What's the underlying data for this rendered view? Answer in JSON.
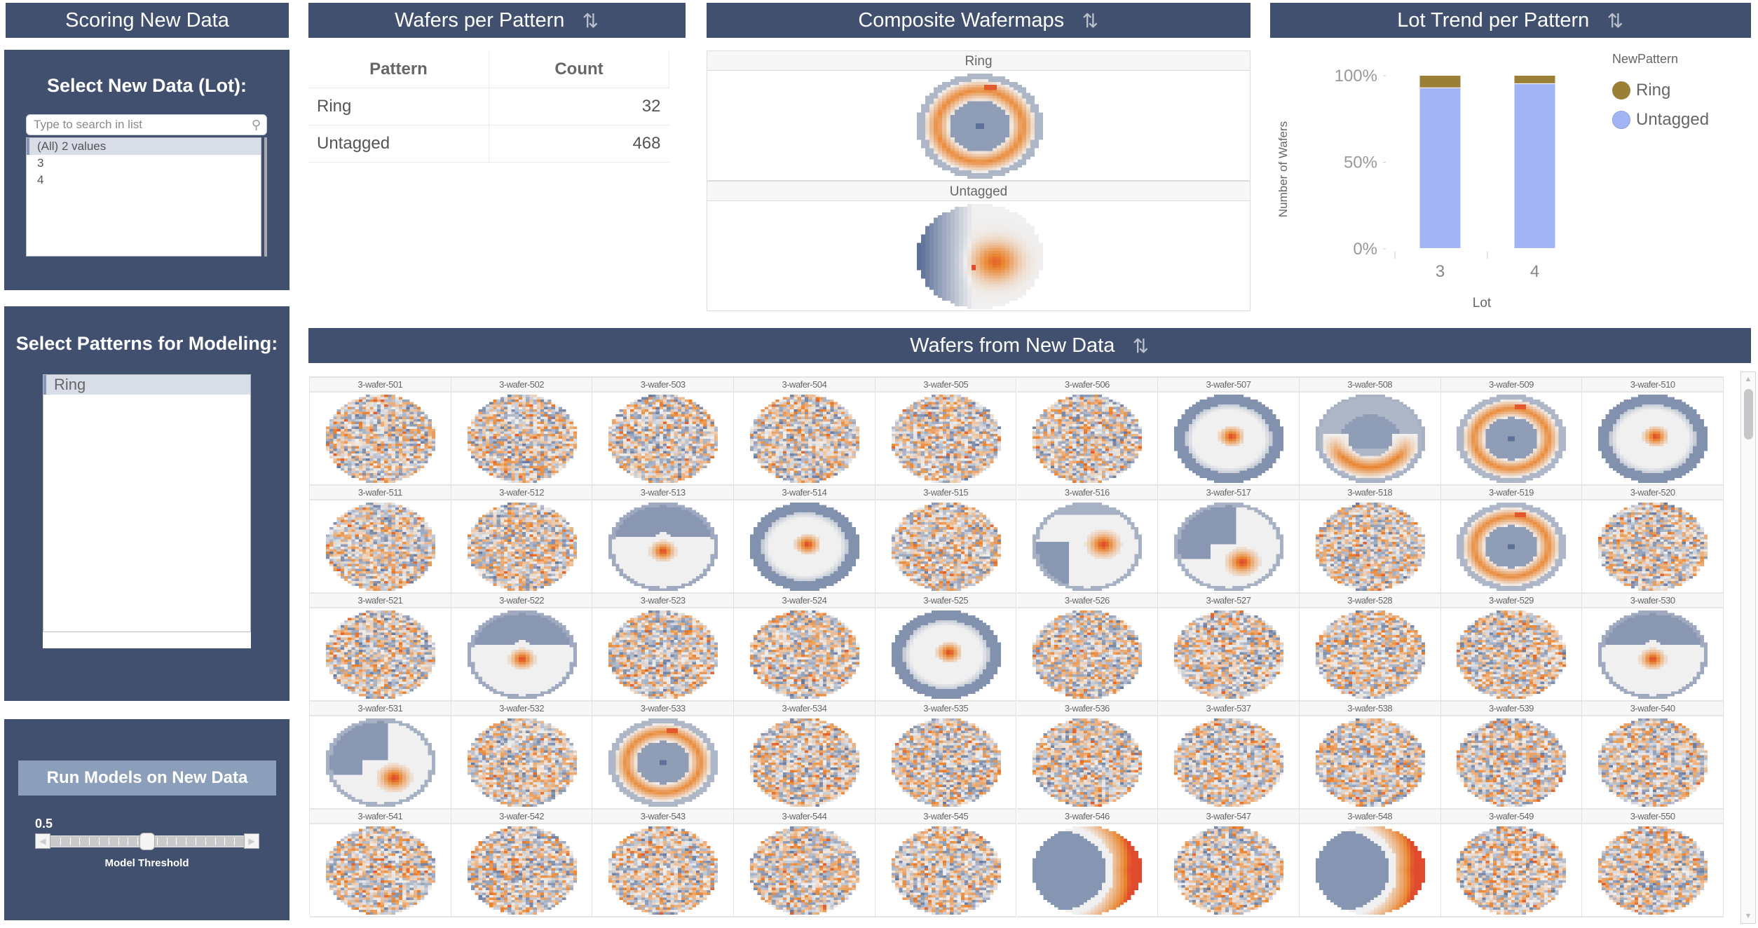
{
  "left": {
    "header_title": "Scoring New Data",
    "lot_panel": {
      "title": "Select New Data (Lot):",
      "search_placeholder": "Type to search in list",
      "items": [
        {
          "label": "(All) 2 values",
          "selected": true
        },
        {
          "label": "3",
          "selected": false
        },
        {
          "label": "4",
          "selected": false
        }
      ]
    },
    "patterns_panel": {
      "title": "Select Patterns for Modeling:",
      "items": [
        {
          "label": "Ring",
          "selected": true
        }
      ]
    },
    "run_panel": {
      "button_label": "Run Models on New Data",
      "slider_value": 0.5,
      "slider_value_label": "0.5",
      "slider_min": 0,
      "slider_max": 1,
      "slider_label": "Model Threshold"
    }
  },
  "wafers_per_pattern": {
    "title": "Wafers per Pattern",
    "refresh_icon": "refresh-icon",
    "columns": [
      "Pattern",
      "Count"
    ],
    "rows": [
      {
        "pattern": "Ring",
        "count": "32"
      },
      {
        "pattern": "Untagged",
        "count": "468"
      }
    ]
  },
  "composite": {
    "title": "Composite Wafermaps",
    "refresh_icon": "refresh-icon",
    "facets": [
      {
        "label": "Ring",
        "pattern": "ring"
      },
      {
        "label": "Untagged",
        "pattern": "composite-untagged"
      }
    ]
  },
  "lot_trend": {
    "title": "Lot Trend per Pattern",
    "refresh_icon": "refresh-icon"
  },
  "chart_data": {
    "type": "bar",
    "stacked": true,
    "title": "Lot Trend per Pattern",
    "xlabel": "Lot",
    "ylabel": "Number of Wafers",
    "categories": [
      "3",
      "4"
    ],
    "series": [
      {
        "name": "Untagged",
        "color": "#a3b4f5",
        "values": [
          92.8,
          95.2
        ]
      },
      {
        "name": "Ring",
        "color": "#9a7f37",
        "values": [
          7.2,
          4.8
        ]
      }
    ],
    "ylim": [
      0,
      100
    ],
    "yticks": [
      0,
      50,
      100
    ],
    "ytick_labels": [
      "0%",
      "50%",
      "100%"
    ],
    "legend_title": "NewPattern",
    "legend_entries": [
      "Ring",
      "Untagged"
    ],
    "legend_position": "top-right",
    "grid": false
  },
  "wafers_grid": {
    "title": "Wafers from New Data",
    "refresh_icon": "refresh-icon",
    "wafers": [
      {
        "id": "3-wafer-501",
        "pattern": "noise"
      },
      {
        "id": "3-wafer-502",
        "pattern": "noise"
      },
      {
        "id": "3-wafer-503",
        "pattern": "noise"
      },
      {
        "id": "3-wafer-504",
        "pattern": "noise"
      },
      {
        "id": "3-wafer-505",
        "pattern": "noise"
      },
      {
        "id": "3-wafer-506",
        "pattern": "noise"
      },
      {
        "id": "3-wafer-507",
        "pattern": "center"
      },
      {
        "id": "3-wafer-508",
        "pattern": "edge-bottom"
      },
      {
        "id": "3-wafer-509",
        "pattern": "ring"
      },
      {
        "id": "3-wafer-510",
        "pattern": "center"
      },
      {
        "id": "3-wafer-511",
        "pattern": "noise"
      },
      {
        "id": "3-wafer-512",
        "pattern": "noise"
      },
      {
        "id": "3-wafer-513",
        "pattern": "heart"
      },
      {
        "id": "3-wafer-514",
        "pattern": "center"
      },
      {
        "id": "3-wafer-515",
        "pattern": "noise"
      },
      {
        "id": "3-wafer-516",
        "pattern": "swirl-left"
      },
      {
        "id": "3-wafer-517",
        "pattern": "swirl"
      },
      {
        "id": "3-wafer-518",
        "pattern": "noise"
      },
      {
        "id": "3-wafer-519",
        "pattern": "ring"
      },
      {
        "id": "3-wafer-520",
        "pattern": "noise"
      },
      {
        "id": "3-wafer-521",
        "pattern": "noise"
      },
      {
        "id": "3-wafer-522",
        "pattern": "heart"
      },
      {
        "id": "3-wafer-523",
        "pattern": "noise"
      },
      {
        "id": "3-wafer-524",
        "pattern": "noise"
      },
      {
        "id": "3-wafer-525",
        "pattern": "center"
      },
      {
        "id": "3-wafer-526",
        "pattern": "noise"
      },
      {
        "id": "3-wafer-527",
        "pattern": "noise"
      },
      {
        "id": "3-wafer-528",
        "pattern": "noise"
      },
      {
        "id": "3-wafer-529",
        "pattern": "noise"
      },
      {
        "id": "3-wafer-530",
        "pattern": "heart"
      },
      {
        "id": "3-wafer-531",
        "pattern": "swirl"
      },
      {
        "id": "3-wafer-532",
        "pattern": "noise"
      },
      {
        "id": "3-wafer-533",
        "pattern": "ring"
      },
      {
        "id": "3-wafer-534",
        "pattern": "noise"
      },
      {
        "id": "3-wafer-535",
        "pattern": "noise"
      },
      {
        "id": "3-wafer-536",
        "pattern": "noise"
      },
      {
        "id": "3-wafer-537",
        "pattern": "noise"
      },
      {
        "id": "3-wafer-538",
        "pattern": "noise"
      },
      {
        "id": "3-wafer-539",
        "pattern": "noise"
      },
      {
        "id": "3-wafer-540",
        "pattern": "noise"
      },
      {
        "id": "3-wafer-541",
        "pattern": "noise"
      },
      {
        "id": "3-wafer-542",
        "pattern": "noise"
      },
      {
        "id": "3-wafer-543",
        "pattern": "noise"
      },
      {
        "id": "3-wafer-544",
        "pattern": "noise"
      },
      {
        "id": "3-wafer-545",
        "pattern": "noise"
      },
      {
        "id": "3-wafer-546",
        "pattern": "edge-right"
      },
      {
        "id": "3-wafer-547",
        "pattern": "noise"
      },
      {
        "id": "3-wafer-548",
        "pattern": "edge-right"
      },
      {
        "id": "3-wafer-549",
        "pattern": "noise"
      },
      {
        "id": "3-wafer-550",
        "pattern": "noise"
      }
    ]
  },
  "colors": {
    "navy": "#42506f",
    "wafer_low": "#5d7198",
    "wafer_mid": "#f0f0f0",
    "wafer_high": "#e9842e",
    "wafer_peak": "#e04b2e"
  }
}
